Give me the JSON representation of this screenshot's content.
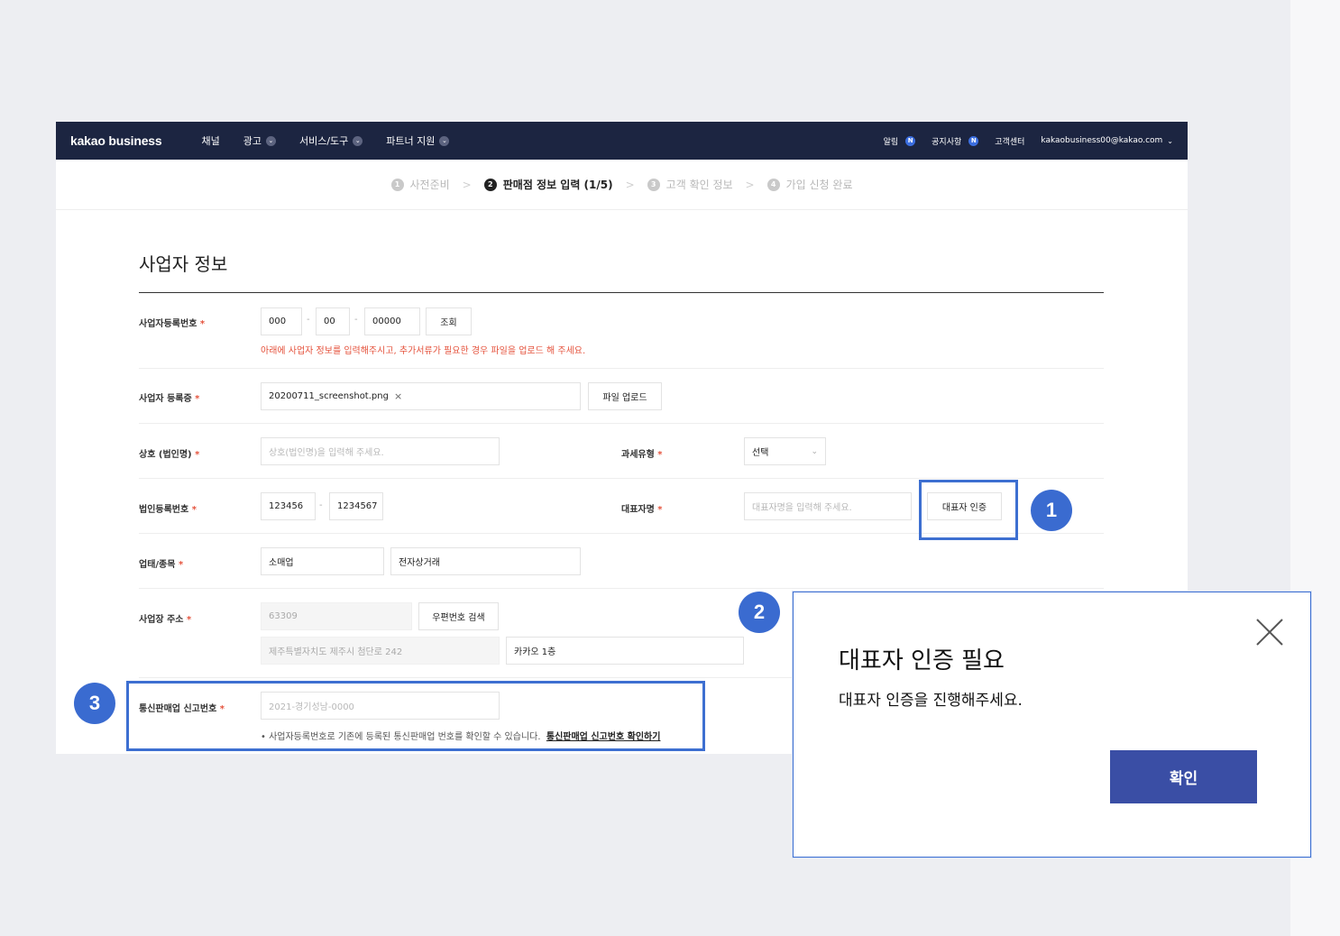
{
  "nav": {
    "logo": "kakao business",
    "items": [
      "채널",
      "광고",
      "서비스/도구",
      "파트너 지원"
    ],
    "right": {
      "alerts": "알림",
      "notices": "공지사항",
      "support": "고객센터",
      "account": "kakaobusiness00@kakao.com",
      "badge": "N"
    }
  },
  "steps": [
    {
      "num": "1",
      "label": "사전준비"
    },
    {
      "num": "2",
      "label": "판매점 정보 입력 (1/5)"
    },
    {
      "num": "3",
      "label": "고객 확인 정보"
    },
    {
      "num": "4",
      "label": "가입 신청 완료"
    }
  ],
  "step_separator": ">",
  "form": {
    "title": "사업자 정보",
    "biz_reg_no": {
      "label": "사업자등록번호",
      "part1": "000",
      "part2": "00",
      "part3": "00000",
      "lookup": "조회",
      "warning": "아래에 사업자 정보를 입력해주시고, 추가서류가 필요한 경우 파일을 업로드 해 주세요."
    },
    "biz_cert": {
      "label": "사업자 등록증",
      "file": "20200711_screenshot.png",
      "upload": "파일 업로드"
    },
    "company_name": {
      "label": "상호 (법인명)",
      "placeholder": "상호(법인명)을 입력해 주세요."
    },
    "tax_type": {
      "label": "과세유형",
      "value": "선택"
    },
    "corp_reg_no": {
      "label": "법인등록번호",
      "part1": "123456",
      "part2": "1234567"
    },
    "ceo_name": {
      "label": "대표자명",
      "placeholder": "대표자명을 입력해 주세요.",
      "verify": "대표자 인증"
    },
    "business_type": {
      "label": "업태/종목",
      "category": "소매업",
      "item": "전자상거래"
    },
    "address": {
      "label": "사업장 주소",
      "zip": "63309",
      "zip_search": "우편번호 검색",
      "addr1": "제주특별자치도 제주시 첨단로 242",
      "addr2": "카카오 1층"
    },
    "ecommerce_no": {
      "label": "통신판매업 신고번호",
      "placeholder": "2021-경기성남-0000",
      "hint": "• 사업자등록번호로 기존에 등록된 통신판매업 번호를 확인할 수 있습니다.",
      "link": "통신판매업 신고번호 확인하기"
    },
    "required_mark": "*"
  },
  "callouts": [
    "1",
    "2",
    "3"
  ],
  "modal": {
    "title": "대표자 인증 필요",
    "message": "대표자 인증을 진행해주세요.",
    "ok": "확인"
  },
  "colors": {
    "nav_bg": "#1c2541",
    "highlight": "#3d6fd1",
    "badge": "#3a6bd0",
    "modal_button": "#3a4ea5",
    "required": "#e5533d"
  }
}
